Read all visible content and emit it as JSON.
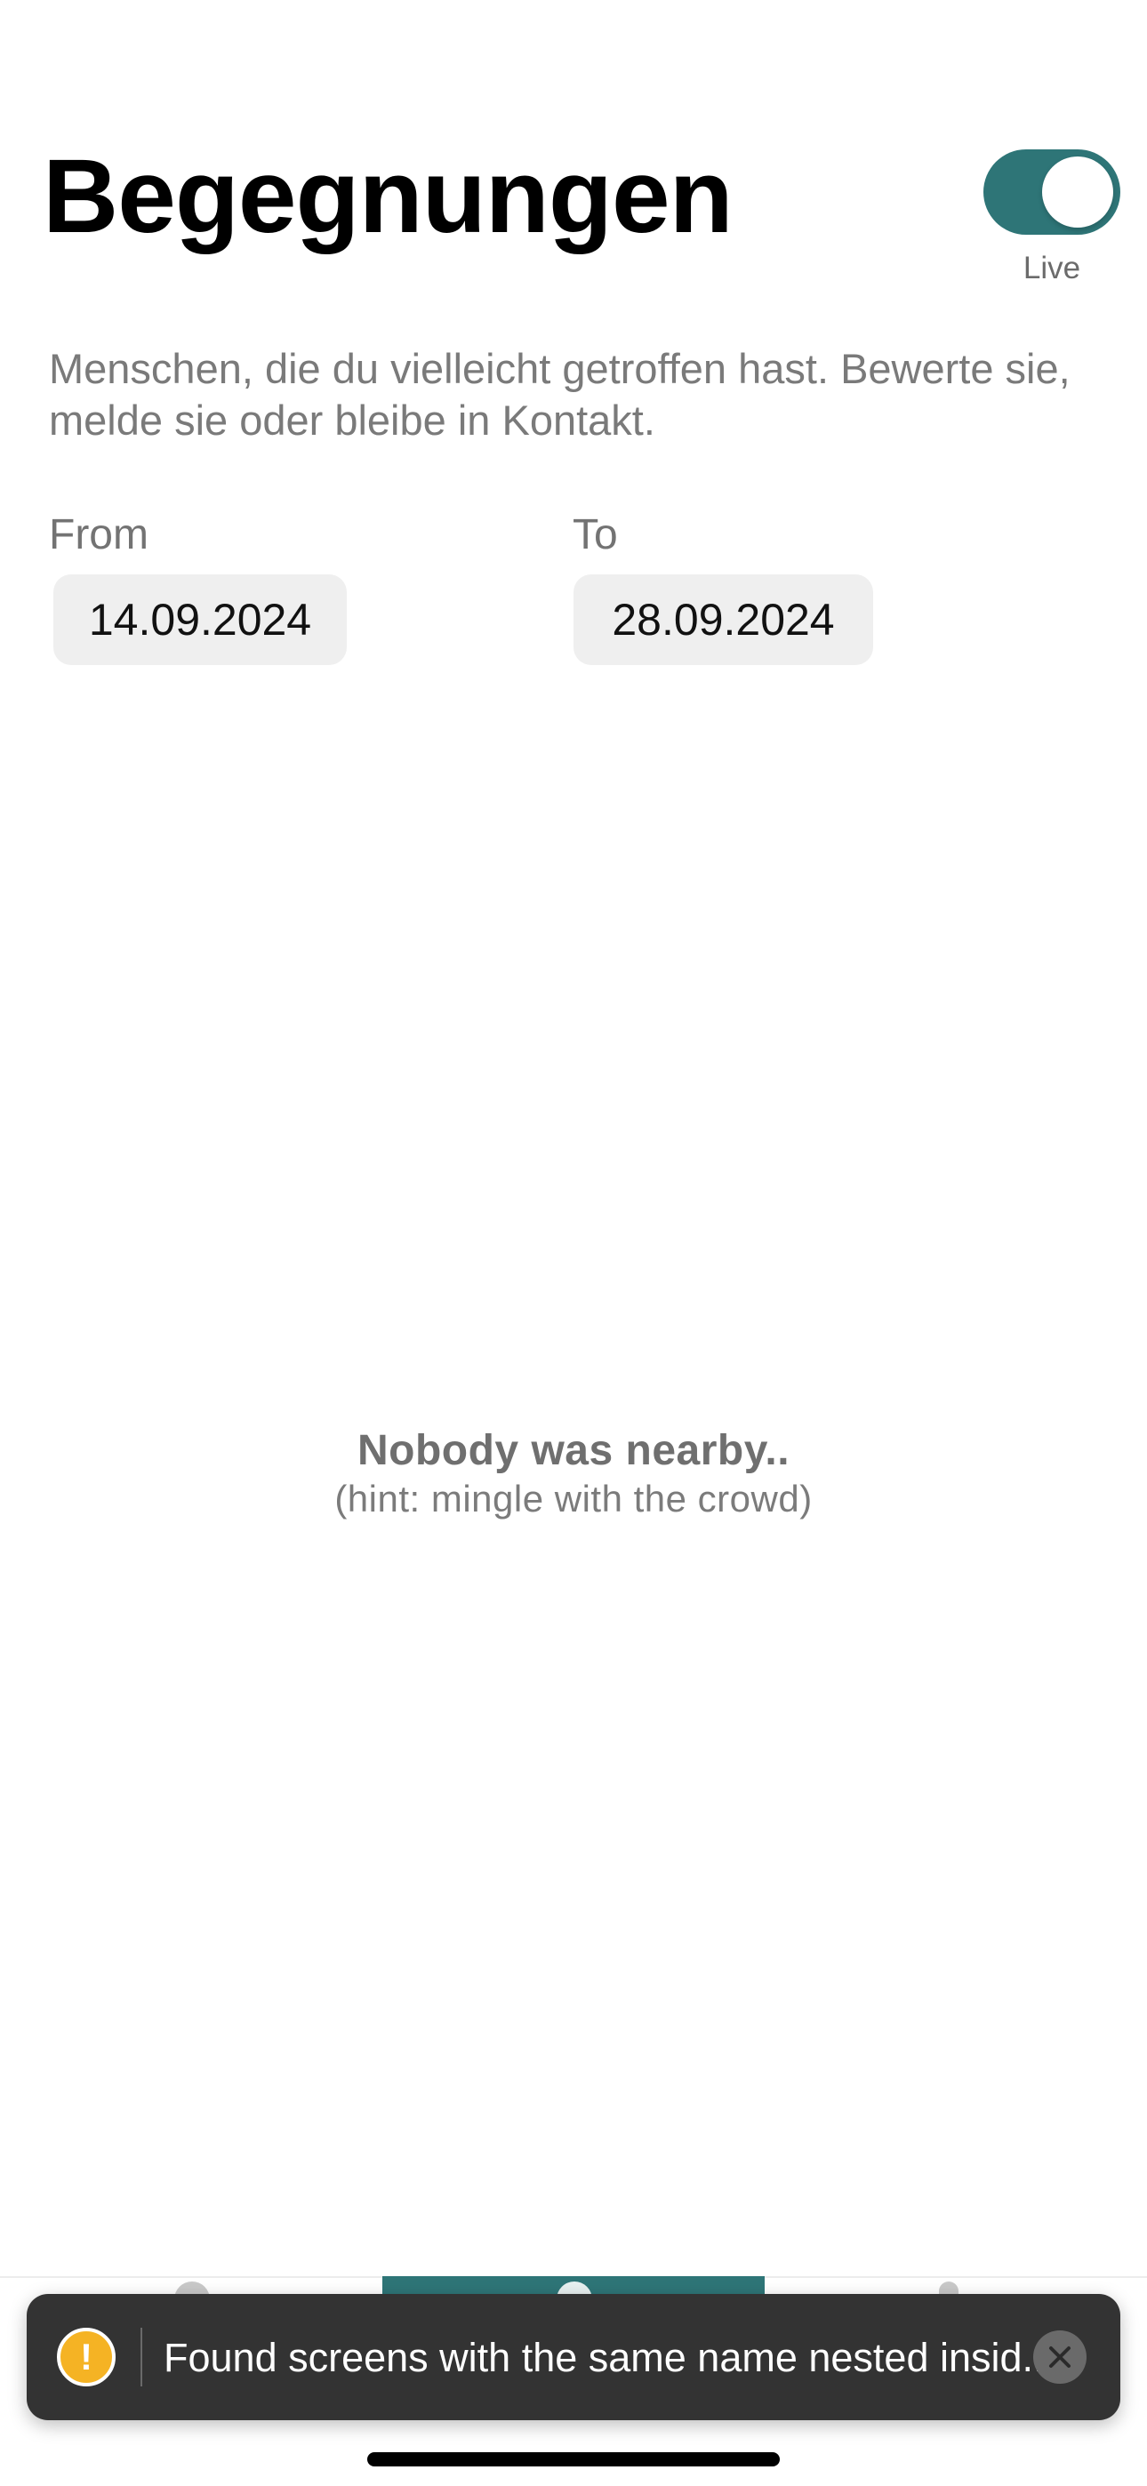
{
  "header": {
    "title": "Begegnungen",
    "live_toggle": {
      "label": "Live",
      "on": true
    }
  },
  "description": "Menschen, die du vielleicht getroffen hast. Bewerte sie, melde sie oder bleibe in Kontakt.",
  "date_range": {
    "from_label": "From",
    "from_value": "14.09.2024",
    "to_label": "To",
    "to_value": "28.09.2024"
  },
  "empty_state": {
    "title": "Nobody was nearby..",
    "hint": "(hint: mingle with the crowd)"
  },
  "toast": {
    "icon": "warning-icon",
    "message": "Found screens with the same name nested insid...",
    "close_icon": "close-icon"
  },
  "colors": {
    "accent": "#2e7577",
    "toast_background": "#333333",
    "warning": "#f5b324"
  }
}
